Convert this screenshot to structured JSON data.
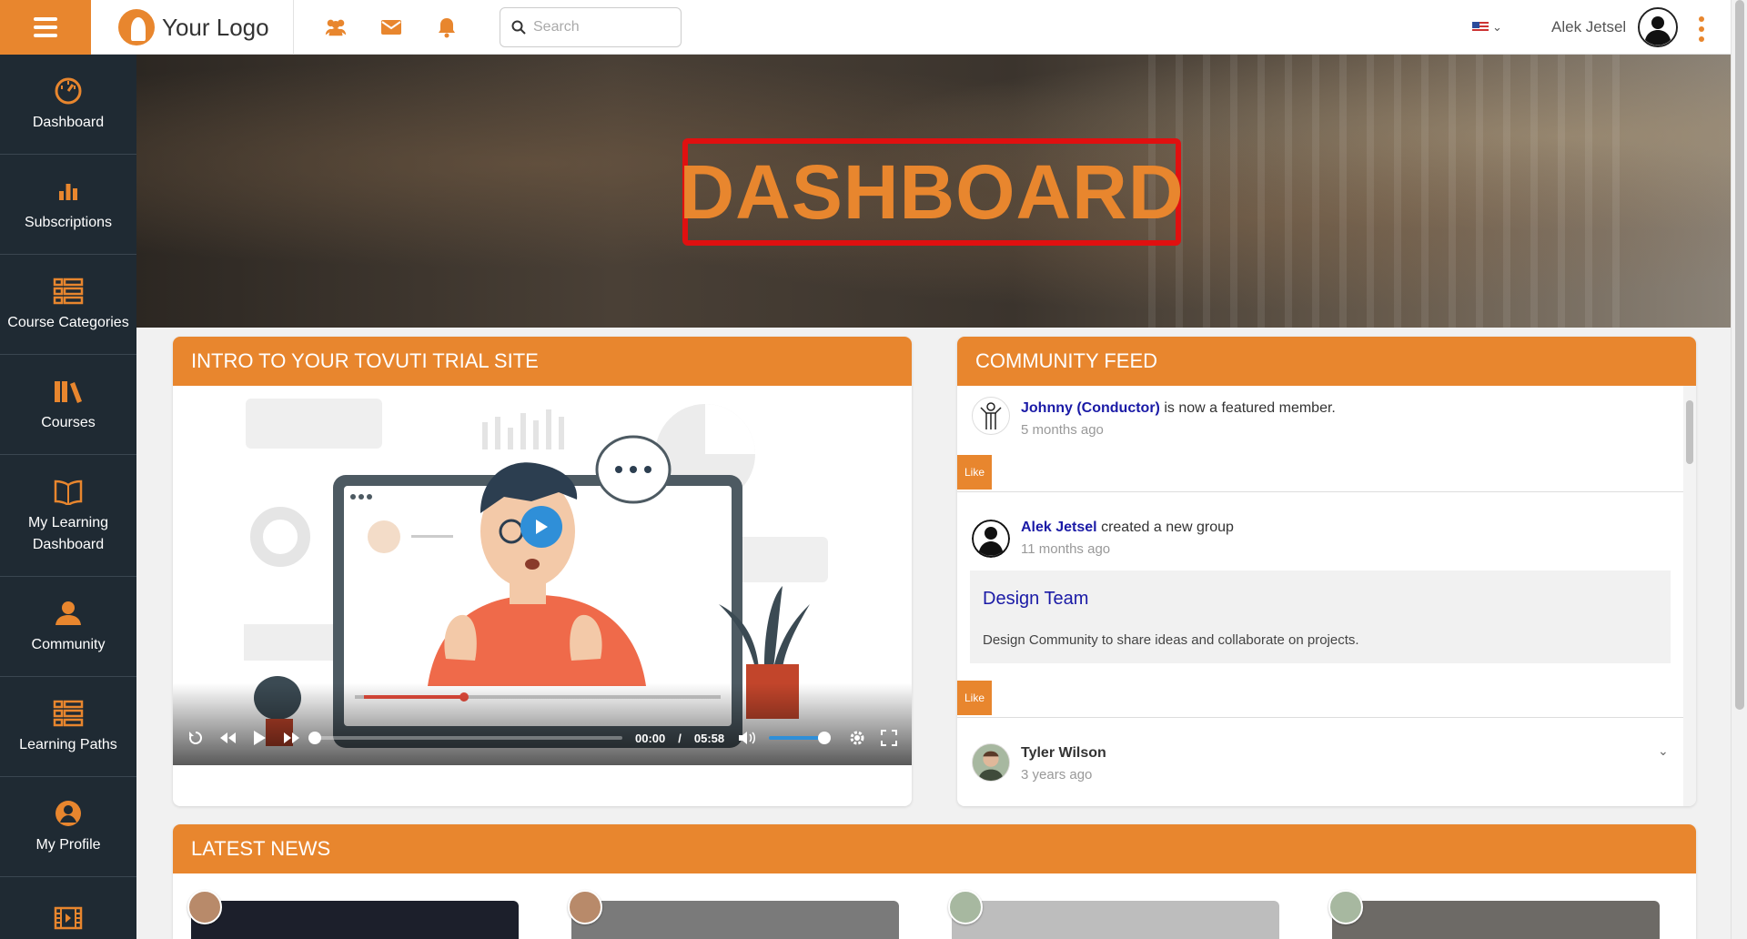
{
  "topbar": {
    "logo_text": "Your Logo",
    "search_placeholder": "Search",
    "username": "Alek Jetsel"
  },
  "sidebar": {
    "items": [
      {
        "label": "Dashboard",
        "icon": "gauge-icon"
      },
      {
        "label": "Subscriptions",
        "icon": "bar-chart-icon"
      },
      {
        "label": "Course Categories",
        "icon": "list-grid-icon"
      },
      {
        "label": "Courses",
        "icon": "books-icon"
      },
      {
        "label": "My Learning Dashboard",
        "icon": "open-book-icon"
      },
      {
        "label": "Community",
        "icon": "community-icon"
      },
      {
        "label": "Learning Paths",
        "icon": "list-grid-icon"
      },
      {
        "label": "My Profile",
        "icon": "user-circle-icon"
      }
    ]
  },
  "hero": {
    "title": "DASHBOARD"
  },
  "intro": {
    "title": "INTRO TO YOUR TOVUTI TRIAL SITE",
    "video": {
      "current_time": "00:00",
      "separator": "/",
      "duration": "05:58",
      "progress": 0,
      "volume": 1.0
    }
  },
  "feed": {
    "title": "COMMUNITY FEED",
    "entries": [
      {
        "name": "Johnny (Conductor)",
        "action": "is now a featured member.",
        "time": "5 months ago",
        "like": "Like"
      },
      {
        "name": "Alek Jetsel",
        "action": "created a new group",
        "time": "11 months ago",
        "like": "Like",
        "group": {
          "title": "Design Team",
          "description": "Design Community to share ideas and collaborate on projects."
        }
      },
      {
        "name": "Tyler Wilson",
        "action": "",
        "time": "3 years ago"
      }
    ]
  },
  "news": {
    "title": "LATEST NEWS"
  },
  "colors": {
    "accent": "#e8862e",
    "sidebar": "#1f2a33",
    "link": "#1a1aa6",
    "hero_frame": "#e01010"
  }
}
